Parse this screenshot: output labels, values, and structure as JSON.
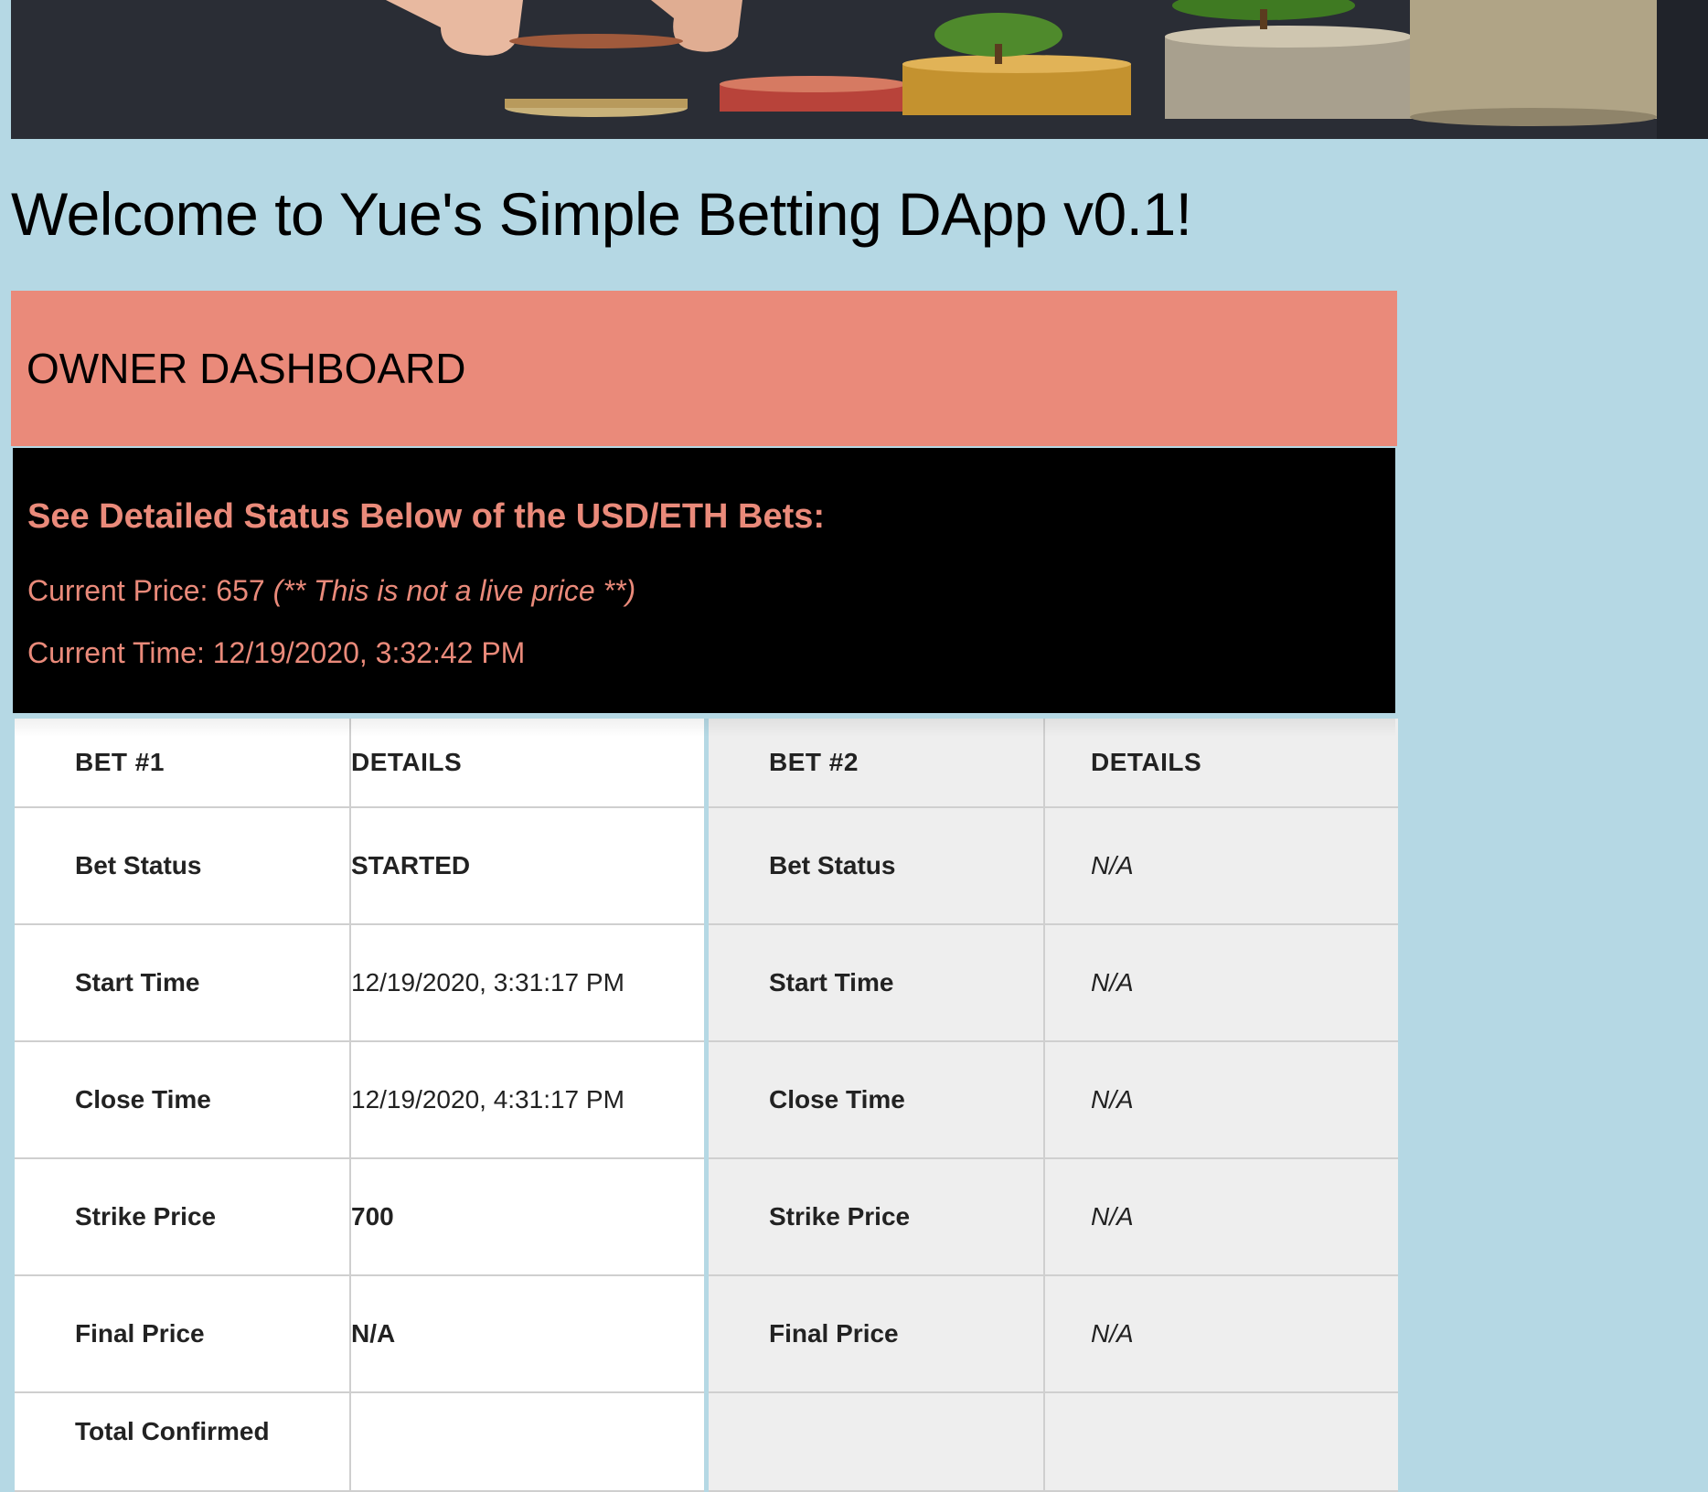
{
  "page": {
    "title": "Welcome to Yue's Simple Betting DApp v0.1!"
  },
  "owner_dashboard": {
    "heading": "OWNER DASHBOARD"
  },
  "status": {
    "title": "See Detailed Status Below of the USD/ETH Bets:",
    "price_label": "Current Price: 657",
    "price_note": "(** This is not a live price **)",
    "time_label": "Current Time: 12/19/2020, 3:32:42 PM"
  },
  "bet1": {
    "header_label": "BET #1",
    "header_details": "DETAILS",
    "rows": [
      {
        "label": "Bet Status",
        "value": "STARTED"
      },
      {
        "label": "Start Time",
        "value": "12/19/2020, 3:31:17 PM"
      },
      {
        "label": "Close Time",
        "value": "12/19/2020, 4:31:17 PM"
      },
      {
        "label": "Strike Price",
        "value": "700"
      },
      {
        "label": "Final Price",
        "value": "N/A"
      },
      {
        "label": "Total Confirmed",
        "value": ""
      }
    ]
  },
  "bet2": {
    "header_label": "BET #2",
    "header_details": "DETAILS",
    "rows": [
      {
        "label": "Bet Status",
        "value": "N/A"
      },
      {
        "label": "Start Time",
        "value": "N/A"
      },
      {
        "label": "Close Time",
        "value": "N/A"
      },
      {
        "label": "Strike Price",
        "value": "N/A"
      },
      {
        "label": "Final Price",
        "value": "N/A"
      },
      {
        "label": "",
        "value": ""
      }
    ]
  },
  "colors": {
    "background": "#b5d8e4",
    "accent": "#ea8a7a",
    "panel": "#000000"
  }
}
